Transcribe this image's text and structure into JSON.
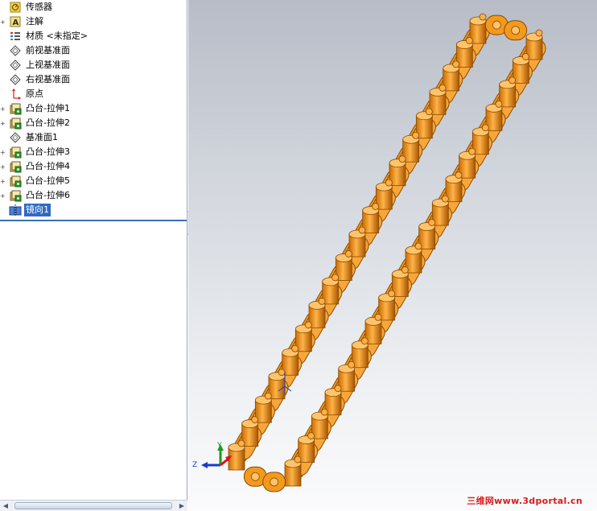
{
  "feature_tree": {
    "items": [
      {
        "label": "传感器",
        "icon": "sensor-icon",
        "expandable": false
      },
      {
        "label": "注解",
        "icon": "annotation-icon",
        "expandable": true
      },
      {
        "label": "材质 <未指定>",
        "icon": "material-icon",
        "expandable": false
      },
      {
        "label": "前视基准面",
        "icon": "plane-icon",
        "expandable": false
      },
      {
        "label": "上视基准面",
        "icon": "plane-icon",
        "expandable": false
      },
      {
        "label": "右视基准面",
        "icon": "plane-icon",
        "expandable": false
      },
      {
        "label": "原点",
        "icon": "origin-icon",
        "expandable": false
      },
      {
        "label": "凸台-拉伸1",
        "icon": "extrude-icon",
        "expandable": true
      },
      {
        "label": "凸台-拉伸2",
        "icon": "extrude-icon",
        "expandable": true
      },
      {
        "label": "基准面1",
        "icon": "plane-icon",
        "expandable": false
      },
      {
        "label": "凸台-拉伸3",
        "icon": "extrude-icon",
        "expandable": true
      },
      {
        "label": "凸台-拉伸4",
        "icon": "extrude-icon",
        "expandable": true
      },
      {
        "label": "凸台-拉伸5",
        "icon": "extrude-icon",
        "expandable": true
      },
      {
        "label": "凸台-拉伸6",
        "icon": "extrude-icon",
        "expandable": true
      },
      {
        "label": "镜向1",
        "icon": "mirror-icon",
        "expandable": false,
        "selected": true
      }
    ]
  },
  "viewport": {
    "triad_labels": {
      "x": "X",
      "y": "Y",
      "z": "Z"
    },
    "watermark": "三维网www.3dportal.cn"
  },
  "colors": {
    "tree_selection": "#316ac5",
    "chain_orange": "#f39a1e",
    "chain_dark": "#8a4a00",
    "watermark": "#d81b1b"
  }
}
